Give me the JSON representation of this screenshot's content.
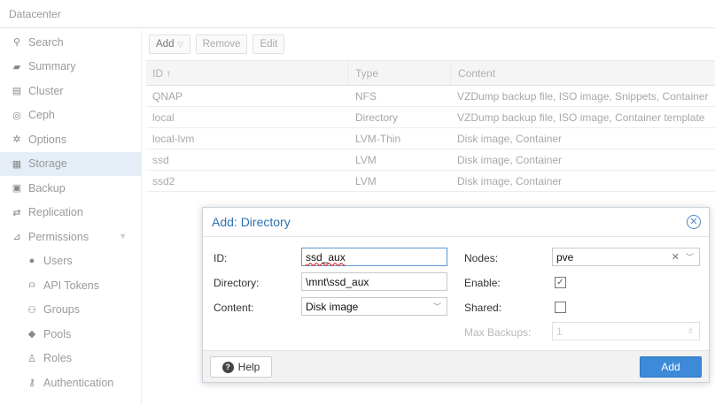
{
  "header": {
    "title": "Datacenter"
  },
  "sidebar": {
    "items": [
      {
        "label": "Search",
        "icon": "search-icon",
        "glyph": "⚲"
      },
      {
        "label": "Summary",
        "icon": "book-icon",
        "glyph": "▰"
      },
      {
        "label": "Cluster",
        "icon": "server-icon",
        "glyph": "▤"
      },
      {
        "label": "Ceph",
        "icon": "ceph-icon",
        "glyph": "◎"
      },
      {
        "label": "Options",
        "icon": "gear-icon",
        "glyph": "✲"
      },
      {
        "label": "Storage",
        "icon": "database-icon",
        "glyph": "▦"
      },
      {
        "label": "Backup",
        "icon": "floppy-icon",
        "glyph": "▣"
      },
      {
        "label": "Replication",
        "icon": "retweet-icon",
        "glyph": "⇄"
      },
      {
        "label": "Permissions",
        "icon": "unlock-icon",
        "glyph": "⊿"
      },
      {
        "label": "Users",
        "icon": "user-icon",
        "glyph": "●"
      },
      {
        "label": "API Tokens",
        "icon": "user-outline-icon",
        "glyph": "⍝"
      },
      {
        "label": "Groups",
        "icon": "users-icon",
        "glyph": "⚇"
      },
      {
        "label": "Pools",
        "icon": "tags-icon",
        "glyph": "◆"
      },
      {
        "label": "Roles",
        "icon": "male-icon",
        "glyph": "♙"
      },
      {
        "label": "Authentication",
        "icon": "key-icon",
        "glyph": "⚷"
      }
    ]
  },
  "toolbar": {
    "add_label": "Add",
    "remove_label": "Remove",
    "edit_label": "Edit"
  },
  "grid": {
    "columns": {
      "id": "ID ↑",
      "type": "Type",
      "content": "Content"
    },
    "rows": [
      {
        "id": "QNAP",
        "type": "NFS",
        "content": "VZDump backup file, ISO image, Snippets, Container"
      },
      {
        "id": "local",
        "type": "Directory",
        "content": "VZDump backup file, ISO image, Container template"
      },
      {
        "id": "local-lvm",
        "type": "LVM-Thin",
        "content": "Disk image, Container"
      },
      {
        "id": "ssd",
        "type": "LVM",
        "content": "Disk image, Container"
      },
      {
        "id": "ssd2",
        "type": "LVM",
        "content": "Disk image, Container"
      }
    ]
  },
  "dialog": {
    "title": "Add: Directory",
    "labels": {
      "id": "ID:",
      "directory": "Directory:",
      "content": "Content:",
      "nodes": "Nodes:",
      "enable": "Enable:",
      "shared": "Shared:",
      "max_backups": "Max Backups:"
    },
    "values": {
      "id": "ssd_aux",
      "directory": "\\mnt\\ssd_aux",
      "content": "Disk image",
      "nodes": "pve",
      "enable": true,
      "shared": false,
      "max_backups": "1"
    },
    "help_label": "Help",
    "add_label": "Add"
  },
  "colors": {
    "accent": "#3d8bd8",
    "title": "#2e6fb3",
    "active_nav": "#e5eef7"
  }
}
